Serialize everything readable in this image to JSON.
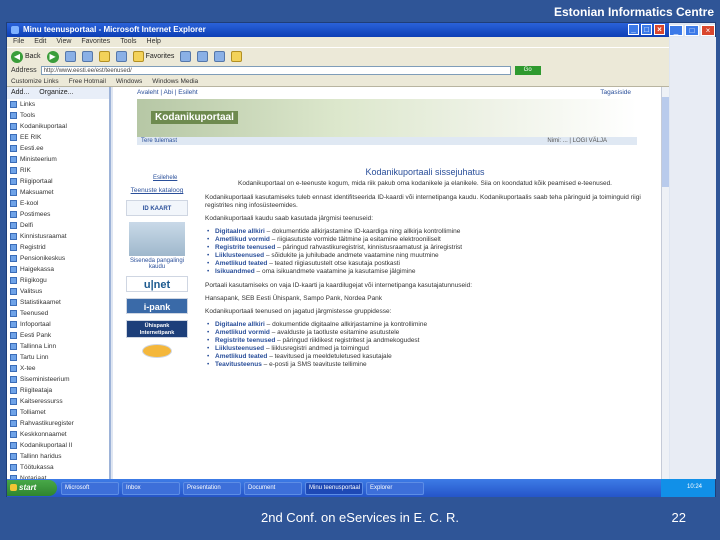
{
  "slide": {
    "header": "Estonian Informatics Centre",
    "footer": "2nd Conf. on eServices in E. C. R.",
    "page_number": "22"
  },
  "browser": {
    "title": "Minu teenusportaal - Microsoft Internet Explorer",
    "menu": [
      "File",
      "Edit",
      "View",
      "Favorites",
      "Tools",
      "Help"
    ],
    "toolbar": [
      "Back",
      "Favorites"
    ],
    "address_label": "Address",
    "address_value": "http://www.eesti.ee/est/teenused/",
    "go_label": "Go",
    "links": [
      "Customize Links",
      "Free Hotmail",
      "Windows",
      "Windows Media"
    ]
  },
  "favorites": {
    "header": [
      "Add...",
      "Organize..."
    ],
    "items": [
      "Links",
      "Tools",
      "Kodanikuportaal",
      "EE RIK",
      "Eesti.ee",
      "Ministeerium",
      "RIK",
      "Riigiportaal",
      "Maksuamet",
      "E-kool",
      "Postimees",
      "Delfi",
      "Kinnistusraamat",
      "Registrid",
      "Pensionikeskus",
      "Haigekassa",
      "Riigikogu",
      "Valitsus",
      "Statistikaamet",
      "Teenused",
      "Infoportaal",
      "Eesti Pank",
      "Tallinna Linn",
      "Tartu Linn",
      "X-tee",
      "Siseministeerium",
      "Riigiteataja",
      "Kaitseressurss",
      "Tolliamet",
      "Rahvastikuregister",
      "Keskkonnaamet",
      "Kodanikuportaal II",
      "Tallinn haridus",
      "Töötukassa",
      "Notariaat",
      "Eesti Raadio"
    ]
  },
  "page": {
    "topnav": "Avaleht | Abi | Esileht",
    "topnav_right": "Tagasiside",
    "banner": "Kodanikuportaal",
    "strip_left": "Tere tulemast",
    "strip_right": "Nimi: ... | LOGI VÄLJA",
    "dot_logo": "Esilehele",
    "title": "Kodanikuportaali sissejuhatus",
    "sub_title": "Kodanikuportaal on e-teenuste kogum, mida riik pakub oma kodanikele ja elanikele. Siia on koondatud kõik peamised e-teenused.",
    "para1": "Kodanikuportaali kasutamiseks tuleb ennast identifitseerida ID-kaardi või internetipanga kaudu. Kodanikuportaalis saab teha päringuid ja toiminguid riigi registrites ning infosüsteemides.",
    "para2": "Kodanikuportaali kaudu saab kasutada järgmisi teenuseid:",
    "list1": [
      {
        "term": "Digitaalne allkiri",
        "text": "– dokumentide allkirjastamine ID-kaardiga ning allkirja kontrollimine"
      },
      {
        "term": "Ametlikud vormid",
        "text": "– riigiasutuste vormide täitmine ja esitamine elektrooniliselt"
      },
      {
        "term": "Registrite teenused",
        "text": "– päringud rahvastikuregistrist, kinnistusraamatust ja äriregistrist"
      },
      {
        "term": "Liiklusteenused",
        "text": "– sõidukite ja juhilubade andmete vaatamine ning muutmine"
      },
      {
        "term": "Ametlikud teated",
        "text": "– teated riigiasutustelt otse kasutaja postkasti"
      },
      {
        "term": "Isikuandmed",
        "text": "– oma isikuandmete vaatamine ja kasutamise jälgimine"
      }
    ],
    "para3": "Portaali kasutamiseks on vaja ID-kaarti ja kaardilugejat või internetipanga kasutajatunnuseid:",
    "para3b": "Hansapank, SEB Eesti Ühispank, Sampo Pank, Nordea Pank",
    "para4": "Kodanikuportaali teenused on jagatud järgmistesse gruppidesse:",
    "list2": [
      {
        "term": "Digitaalne allkiri",
        "text": "– dokumentide digitaalne allkirjastamine ja kontrollimine"
      },
      {
        "term": "Ametlikud vormid",
        "text": "– avalduste ja taotluste esitamine asutustele"
      },
      {
        "term": "Registrite teenused",
        "text": "– päringud riiklikest registritest ja andmekogudest"
      },
      {
        "term": "Liiklusteenused",
        "text": "– liiklusregistri andmed ja toimingud"
      },
      {
        "term": "Ametlikud teated",
        "text": "– teavitused ja meeldetuletused kasutajale"
      },
      {
        "term": "Teavitusteenus",
        "text": "– e-posti ja SMS teavituste tellimine"
      }
    ],
    "side_link": "Teenuste kataloog",
    "side_caption": "Siseneda pangalingi kaudu",
    "badges": [
      "ID KAART",
      "u|net",
      "i-pank",
      "Ühispank Internetipank",
      ""
    ]
  },
  "taskbar": {
    "start": "start",
    "items": [
      "Microsoft",
      "Inbox",
      "Presentation",
      "Document",
      "Minu teenusportaal",
      "Explorer"
    ],
    "clock": "10:24"
  }
}
